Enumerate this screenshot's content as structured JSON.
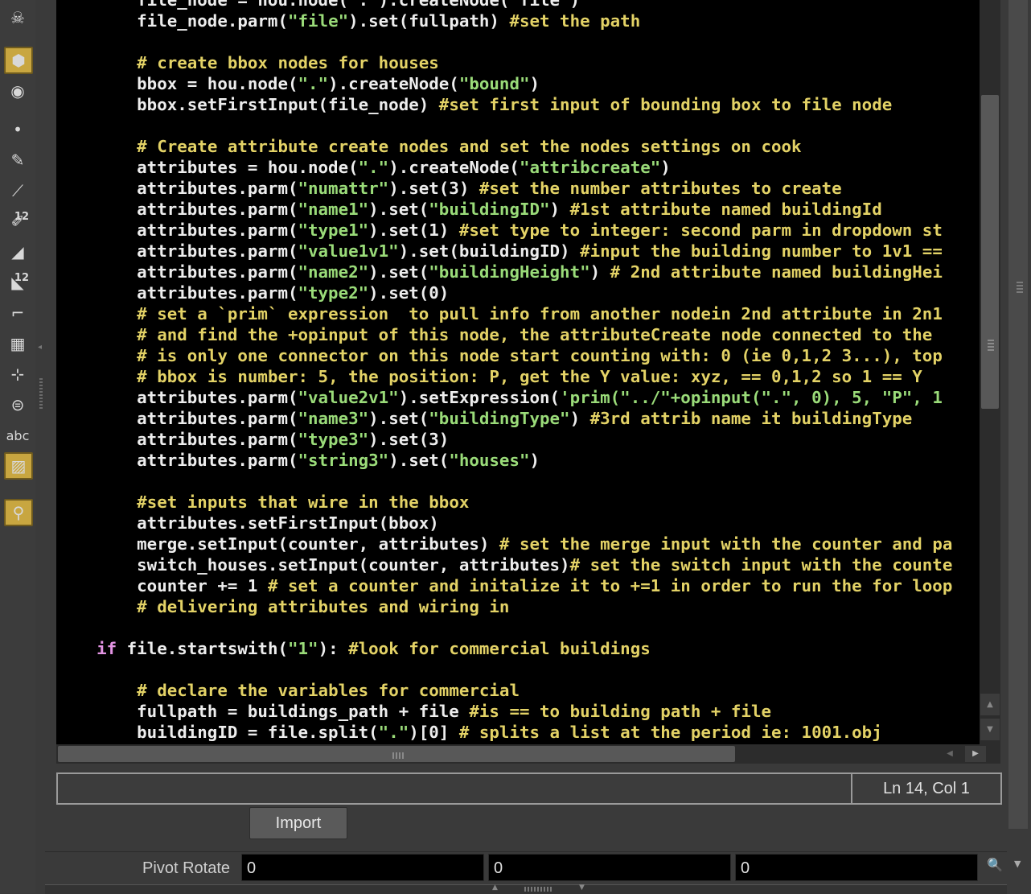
{
  "toolbar": {
    "tools": [
      {
        "icon": "skeleton-icon"
      },
      {
        "icon": "object-box-icon",
        "active": true
      },
      {
        "icon": "visibility-eye-icon"
      },
      {
        "icon": "point-icon"
      },
      {
        "icon": "brush-icon"
      },
      {
        "icon": "pipette-icon"
      },
      {
        "icon": "paint-numbered-icon",
        "badge": "12"
      },
      {
        "icon": "eraser-icon"
      },
      {
        "icon": "paint-numbered-2-icon",
        "badge": "12"
      },
      {
        "icon": "curve-tool-icon"
      },
      {
        "icon": "grid-icon"
      },
      {
        "icon": "measure-icon"
      },
      {
        "icon": "circle-stack-icon"
      },
      {
        "icon": "text-abc-icon",
        "label": "abc"
      },
      {
        "icon": "image-icon",
        "active": true
      },
      {
        "icon": "location-pin-icon",
        "active": true
      }
    ]
  },
  "editor": {
    "lines": [
      [
        {
          "t": "        file_node = hou.node(\".\").createNode(\"file\")"
        }
      ],
      [
        {
          "t": "        file_node.parm("
        },
        {
          "t": "\"file\"",
          "c": "s"
        },
        {
          "t": ").set(fullpath) "
        },
        {
          "t": "#set the path",
          "c": "c"
        }
      ],
      [
        {
          "t": ""
        }
      ],
      [
        {
          "t": "        "
        },
        {
          "t": "# create bbox nodes for houses",
          "c": "c"
        }
      ],
      [
        {
          "t": "        bbox = hou.node("
        },
        {
          "t": "\".\"",
          "c": "s"
        },
        {
          "t": ").createNode("
        },
        {
          "t": "\"bound\"",
          "c": "s"
        },
        {
          "t": ")"
        }
      ],
      [
        {
          "t": "        bbox.setFirstInput(file_node) "
        },
        {
          "t": "#set first input of bounding box to file node",
          "c": "c"
        }
      ],
      [
        {
          "t": ""
        }
      ],
      [
        {
          "t": "        "
        },
        {
          "t": "# Create attribute create nodes and set the nodes settings on cook",
          "c": "c"
        }
      ],
      [
        {
          "t": "        attributes = hou.node("
        },
        {
          "t": "\".\"",
          "c": "s"
        },
        {
          "t": ").createNode("
        },
        {
          "t": "\"attribcreate\"",
          "c": "s"
        },
        {
          "t": ")"
        }
      ],
      [
        {
          "t": "        attributes.parm("
        },
        {
          "t": "\"numattr\"",
          "c": "s"
        },
        {
          "t": ").set(3) "
        },
        {
          "t": "#set the number attributes to create",
          "c": "c"
        }
      ],
      [
        {
          "t": "        attributes.parm("
        },
        {
          "t": "\"name1\"",
          "c": "s"
        },
        {
          "t": ").set("
        },
        {
          "t": "\"buildingID\"",
          "c": "s"
        },
        {
          "t": ") "
        },
        {
          "t": "#1st attribute named buildingId",
          "c": "c"
        }
      ],
      [
        {
          "t": "        attributes.parm("
        },
        {
          "t": "\"type1\"",
          "c": "s"
        },
        {
          "t": ").set(1) "
        },
        {
          "t": "#set type to integer: second parm in dropdown st",
          "c": "c"
        }
      ],
      [
        {
          "t": "        attributes.parm("
        },
        {
          "t": "\"value1v1\"",
          "c": "s"
        },
        {
          "t": ").set(buildingID) "
        },
        {
          "t": "#input the building number to 1v1 ==",
          "c": "c"
        }
      ],
      [
        {
          "t": "        attributes.parm("
        },
        {
          "t": "\"name2\"",
          "c": "s"
        },
        {
          "t": ").set("
        },
        {
          "t": "\"buildingHeight\"",
          "c": "s"
        },
        {
          "t": ") "
        },
        {
          "t": "# 2nd attribute named buildingHei",
          "c": "c"
        }
      ],
      [
        {
          "t": "        attributes.parm("
        },
        {
          "t": "\"type2\"",
          "c": "s"
        },
        {
          "t": ").set(0)"
        }
      ],
      [
        {
          "t": "        "
        },
        {
          "t": "# set a `prim` expression  to pull info from another nodein 2nd attribute in 2n1",
          "c": "c"
        }
      ],
      [
        {
          "t": "        "
        },
        {
          "t": "# and find the +opinput of this node, the attributeCreate node connected to the ",
          "c": "c"
        }
      ],
      [
        {
          "t": "        "
        },
        {
          "t": "# is only one connector on this node start counting with: 0 (ie 0,1,2 3...), top",
          "c": "c"
        }
      ],
      [
        {
          "t": "        "
        },
        {
          "t": "# bbox is number: 5, the position: P, get the Y value: xyz, == 0,1,2 so 1 == Y",
          "c": "c"
        }
      ],
      [
        {
          "t": "        attributes.parm("
        },
        {
          "t": "\"value2v1\"",
          "c": "s"
        },
        {
          "t": ").setExpression("
        },
        {
          "t": "'prim(\"../\"+opinput(\".\", 0), 5, \"P\", 1",
          "c": "s"
        }
      ],
      [
        {
          "t": "        attributes.parm("
        },
        {
          "t": "\"name3\"",
          "c": "s"
        },
        {
          "t": ").set("
        },
        {
          "t": "\"buildingType\"",
          "c": "s"
        },
        {
          "t": ") "
        },
        {
          "t": "#3rd attrib name it buildingType",
          "c": "c"
        }
      ],
      [
        {
          "t": "        attributes.parm("
        },
        {
          "t": "\"type3\"",
          "c": "s"
        },
        {
          "t": ").set(3)"
        }
      ],
      [
        {
          "t": "        attributes.parm("
        },
        {
          "t": "\"string3\"",
          "c": "s"
        },
        {
          "t": ").set("
        },
        {
          "t": "\"houses\"",
          "c": "s"
        },
        {
          "t": ")"
        }
      ],
      [
        {
          "t": ""
        }
      ],
      [
        {
          "t": "        "
        },
        {
          "t": "#set inputs that wire in the bbox",
          "c": "c"
        }
      ],
      [
        {
          "t": "        attributes.setFirstInput(bbox)"
        }
      ],
      [
        {
          "t": "        merge.setInput(counter, attributes) "
        },
        {
          "t": "# set the merge input with the counter and pa",
          "c": "c"
        }
      ],
      [
        {
          "t": "        switch_houses.setInput(counter, attributes)"
        },
        {
          "t": "# set the switch input with the counte",
          "c": "c"
        }
      ],
      [
        {
          "t": "        counter += 1 "
        },
        {
          "t": "# set a counter and initalize it to +=1 in order to run the for loop",
          "c": "c"
        }
      ],
      [
        {
          "t": "        "
        },
        {
          "t": "# delivering attributes and wiring in",
          "c": "c"
        }
      ],
      [
        {
          "t": ""
        }
      ],
      [
        {
          "t": "    "
        },
        {
          "t": "if",
          "c": "k"
        },
        {
          "t": " file.startswith("
        },
        {
          "t": "\"1\"",
          "c": "s"
        },
        {
          "t": "): "
        },
        {
          "t": "#look for commercial buildings",
          "c": "c"
        }
      ],
      [
        {
          "t": ""
        }
      ],
      [
        {
          "t": "        "
        },
        {
          "t": "# declare the variables for commercial",
          "c": "c"
        }
      ],
      [
        {
          "t": "        fullpath = buildings_path + file "
        },
        {
          "t": "#is == to building path + file",
          "c": "c"
        }
      ],
      [
        {
          "t": "        buildingID = file.split("
        },
        {
          "t": "\".\"",
          "c": "s"
        },
        {
          "t": ")[0] "
        },
        {
          "t": "# splits a list at the period ie: 1001.obj",
          "c": "c"
        }
      ]
    ]
  },
  "status": {
    "message": "",
    "cursor_position": "Ln 14, Col 1"
  },
  "import_button": {
    "label": "Import"
  },
  "pivot_rotate": {
    "label": "Pivot Rotate",
    "x": "0",
    "y": "0",
    "z": "0"
  }
}
